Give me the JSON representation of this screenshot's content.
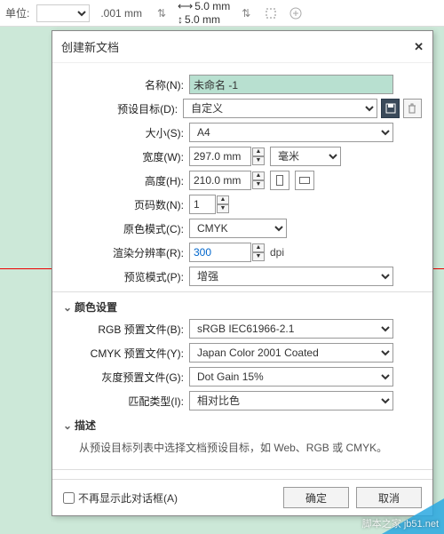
{
  "toolbar": {
    "unit_label": "单位:",
    "precision": ".001 mm",
    "dx": "5.0 mm",
    "dy": "5.0 mm"
  },
  "dialog": {
    "title": "创建新文档",
    "labels": {
      "name": "名称(N):",
      "preset": "预设目标(D):",
      "size": "大小(S):",
      "width": "宽度(W):",
      "height": "高度(H):",
      "pages": "页码数(N):",
      "colormode": "原色模式(C):",
      "res": "渲染分辨率(R):",
      "preview": "预览模式(P):",
      "rgb": "RGB 预置文件(B):",
      "cmyk": "CMYK 预置文件(Y):",
      "gray": "灰度预置文件(G):",
      "intent": "匹配类型(I):"
    },
    "values": {
      "name": "未命名 -1",
      "preset": "自定义",
      "size": "A4",
      "width": "297.0 mm",
      "height": "210.0 mm",
      "width_unit": "毫米",
      "pages": "1",
      "colormode": "CMYK",
      "res": "300",
      "res_unit": "dpi",
      "preview": "增强",
      "rgb": "sRGB IEC61966-2.1",
      "cmyk": "Japan Color 2001 Coated",
      "gray": "Dot Gain 15%",
      "intent": "相对比色"
    },
    "sections": {
      "color": "颜色设置",
      "desc": "描述"
    },
    "desc_text": "从预设目标列表中选择文档预设目标，如 Web、RGB 或 CMYK。",
    "dont_show": "不再显示此对话框(A)",
    "ok": "确定",
    "cancel": "取消"
  },
  "watermark": "脚本之家 jb51.net"
}
